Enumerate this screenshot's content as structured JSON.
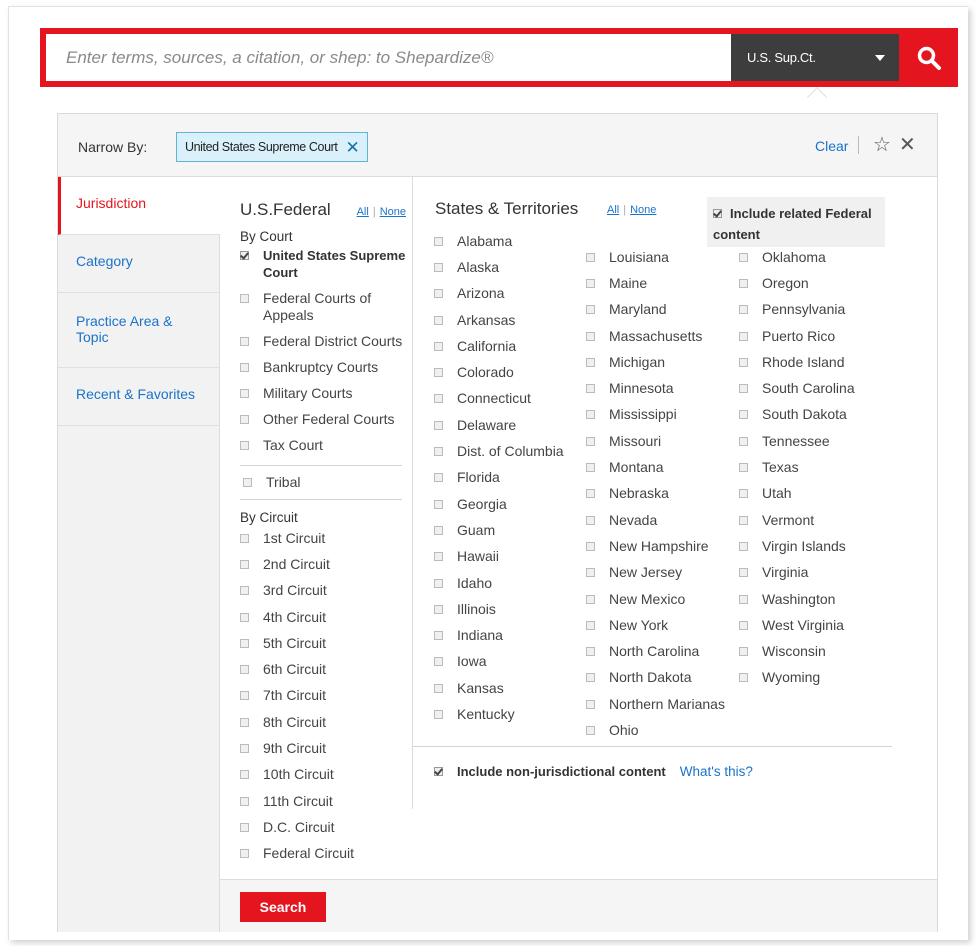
{
  "search": {
    "placeholder": "Enter terms, sources, a citation, or shep: to Shepardize®",
    "court_selected": "U.S. Sup.Ct."
  },
  "narrow": {
    "label": "Narrow By:",
    "chip": "United States Supreme Court",
    "clear": "Clear"
  },
  "sidebar": {
    "items": [
      {
        "label": "Jurisdiction",
        "active": true
      },
      {
        "label": "Category"
      },
      {
        "label": "Practice Area & Topic"
      },
      {
        "label": "Recent & Favorites"
      }
    ]
  },
  "federal": {
    "title": "U.S.Federal",
    "all": "All",
    "none": "None",
    "by_court": "By Court",
    "courts": [
      {
        "label": "United States Supreme Court",
        "checked": true
      },
      {
        "label": "Federal Courts of Appeals"
      },
      {
        "label": "Federal District Courts"
      },
      {
        "label": "Bankruptcy Courts"
      },
      {
        "label": "Military Courts"
      },
      {
        "label": "Other Federal Courts"
      },
      {
        "label": "Tax Court"
      }
    ],
    "tribal": "Tribal",
    "by_circuit": "By Circuit",
    "circuits": [
      "1st Circuit",
      "2nd Circuit",
      "3rd Circuit",
      "4th Circuit",
      "5th Circuit",
      "6th Circuit",
      "7th Circuit",
      "8th Circuit",
      "9th Circuit",
      "10th Circuit",
      "11th Circuit",
      "D.C. Circuit",
      "Federal Circuit"
    ]
  },
  "states": {
    "title": "States & Territories",
    "all": "All",
    "none": "None",
    "include_related": "Include related Federal content",
    "col1": [
      "Alabama",
      "Alaska",
      "Arizona",
      "Arkansas",
      "California",
      "Colorado",
      "Connecticut",
      "Delaware",
      "Dist. of Columbia",
      "Florida",
      "Georgia",
      "Guam",
      "Hawaii",
      "Idaho",
      "Illinois",
      "Indiana",
      "Iowa",
      "Kansas",
      "Kentucky"
    ],
    "col2": [
      "Louisiana",
      "Maine",
      "Maryland",
      "Massachusetts",
      "Michigan",
      "Minnesota",
      "Mississippi",
      "Missouri",
      "Montana",
      "Nebraska",
      "Nevada",
      "New Hampshire",
      "New Jersey",
      "New Mexico",
      "New York",
      "North Carolina",
      "North Dakota",
      "Northern Marianas",
      "Ohio"
    ],
    "col3": [
      "Oklahoma",
      "Oregon",
      "Pennsylvania",
      "Puerto Rico",
      "Rhode Island",
      "South Carolina",
      "South Dakota",
      "Tennessee",
      "Texas",
      "Utah",
      "Vermont",
      "Virgin Islands",
      "Virginia",
      "Washington",
      "West Virginia",
      "Wisconsin",
      "Wyoming"
    ]
  },
  "nonjur": {
    "label": "Include non-jurisdictional content",
    "whats_this": "What's this?"
  },
  "submit": "Search",
  "colors": {
    "accent": "#e4151f",
    "link": "#1a73c8",
    "dark": "#3d3d3d"
  }
}
